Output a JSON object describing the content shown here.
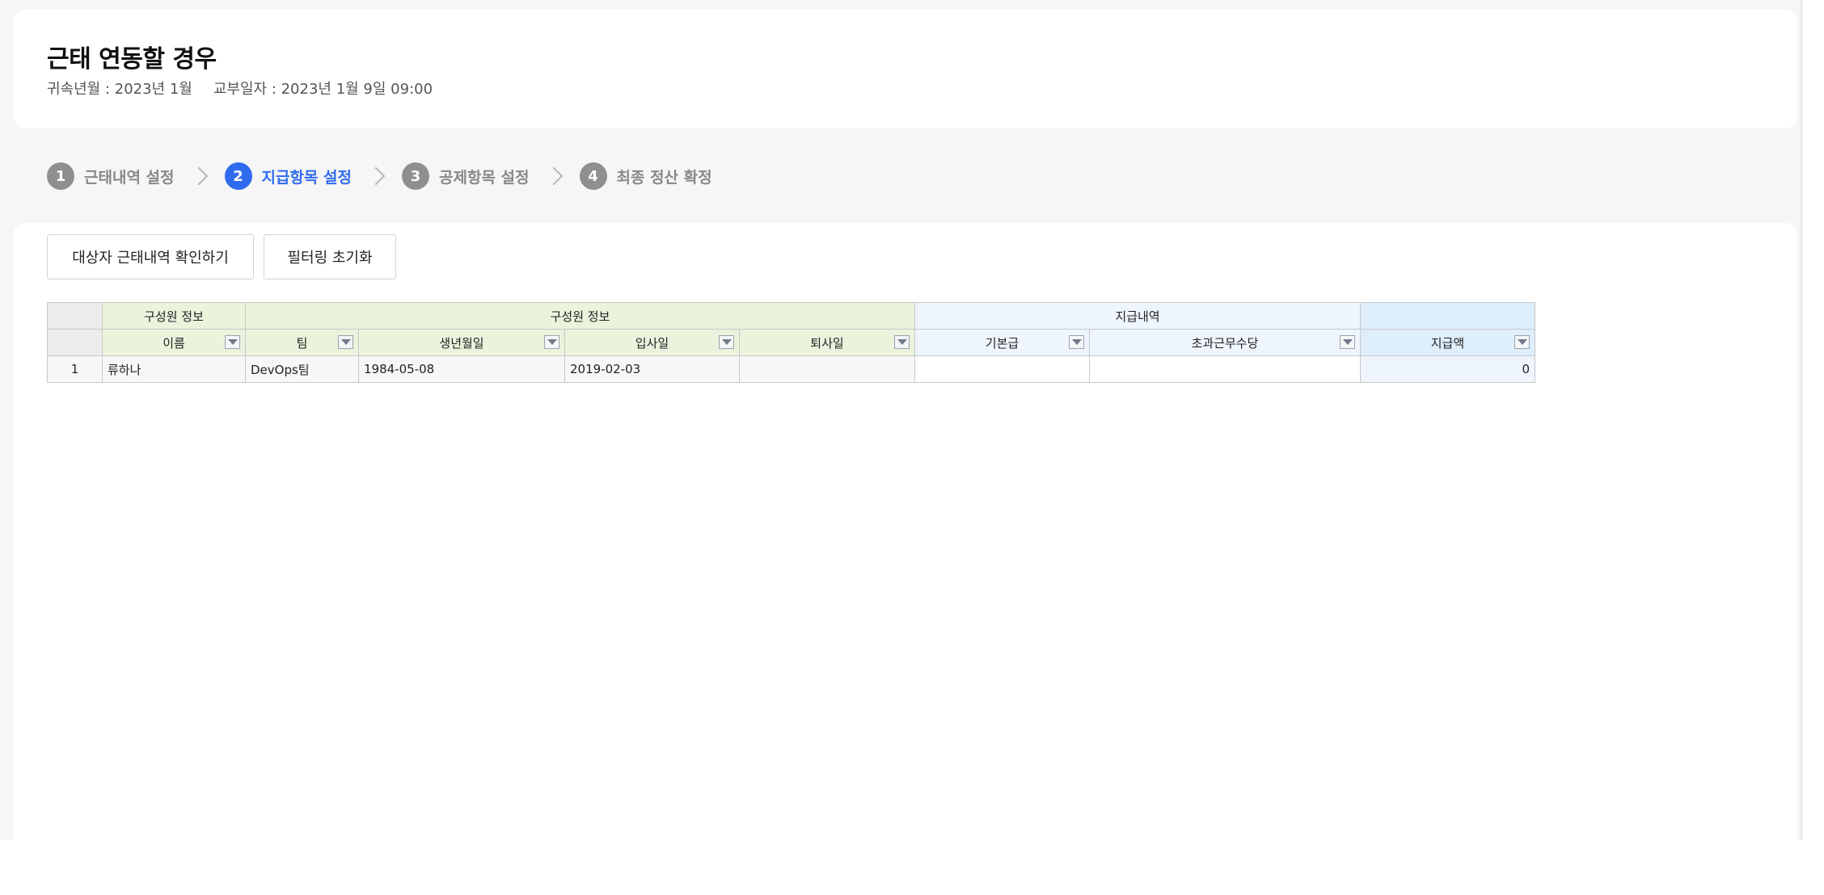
{
  "header": {
    "title": "근태 연동할 경우",
    "period": "귀속년월 : 2023년 1월",
    "issue_date": "교부일자 : 2023년 1월 9일 09:00"
  },
  "stepper": [
    {
      "num": "1",
      "label": "근태내역 설정",
      "active": false
    },
    {
      "num": "2",
      "label": "지급항목 설정",
      "active": true
    },
    {
      "num": "3",
      "label": "공제항목 설정",
      "active": false
    },
    {
      "num": "4",
      "label": "최종 정산 확정",
      "active": false
    }
  ],
  "toolbar": {
    "check_attendance_label": "대상자 근태내역 확인하기",
    "reset_filter_label": "필터링 초기화"
  },
  "grid": {
    "group_headers": [
      "구성원 정보",
      "구성원 정보",
      "지급내역",
      ""
    ],
    "columns": [
      "이름",
      "팀",
      "생년월일",
      "입사일",
      "퇴사일",
      "기본급",
      "초과근무수당",
      "지급액"
    ],
    "rows": [
      {
        "no": "1",
        "name": "류하나",
        "team": "DevOps팀",
        "birth": "1984-05-08",
        "join": "2019-02-03",
        "leave": "",
        "base": "",
        "overtime": "",
        "total": "0"
      }
    ]
  },
  "colors": {
    "accent": "#2f6bef",
    "step_inactive": "#8f8f8f",
    "header_green": "#ebf3dd",
    "header_blue": "#eef5fd"
  }
}
